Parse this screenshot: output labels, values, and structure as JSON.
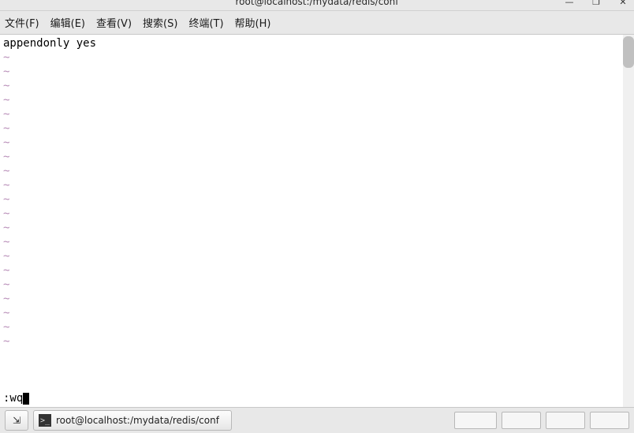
{
  "titlebar": {
    "title": "root@localhost:/mydata/redis/conf"
  },
  "window_buttons": {
    "minimize": "—",
    "maximize": "❐",
    "close": "✕"
  },
  "menubar": {
    "file": "文件(F)",
    "edit": "编辑(E)",
    "view": "查看(V)",
    "search": "搜索(S)",
    "term": "终端(T)",
    "help": "帮助(H)"
  },
  "editor": {
    "content_line_1": "appendonly yes",
    "tilde_char": "~",
    "tilde_count": 21,
    "command_line": ":wq"
  },
  "taskbar": {
    "workspace_glyph": "⇲",
    "term_glyph": ">_",
    "app_label": "root@localhost:/mydata/redis/conf"
  }
}
